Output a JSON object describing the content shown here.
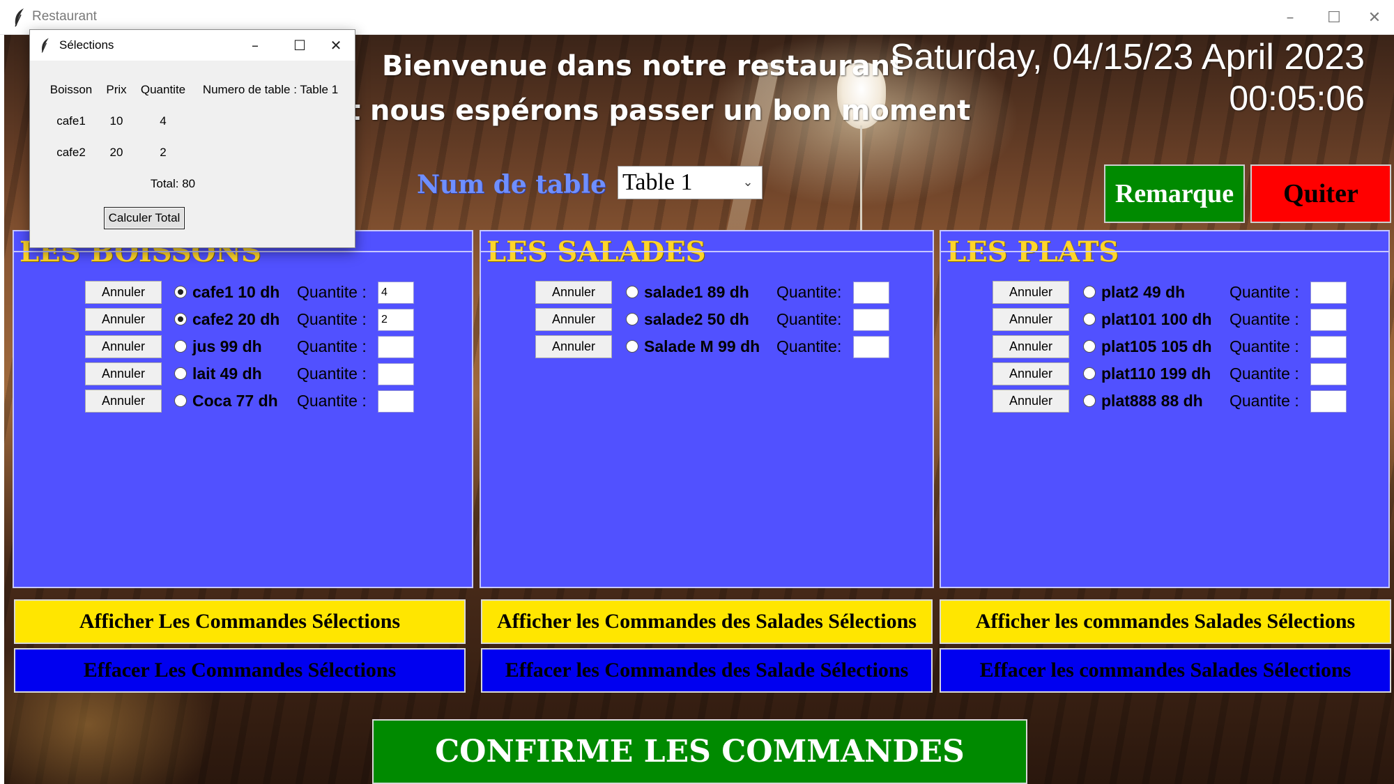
{
  "window": {
    "title": "Restaurant"
  },
  "header": {
    "welcome_line1": "Bienvenue dans notre restaurant",
    "welcome_line2": "t nous espérons passer un bon moment",
    "date": "Saturday, 04/15/23 April 2023",
    "time": "00:05:06"
  },
  "table_select": {
    "label": "Num de table",
    "value": "Table 1"
  },
  "buttons": {
    "remarque": "Remarque",
    "quiter": "Quiter",
    "confirm": "CONFIRME LES COMMANDES"
  },
  "colors": {
    "panel": "#5151ff",
    "title_yellow": "#ffd52a",
    "remarque_bg": "#008a00",
    "quiter_bg": "#ff0000",
    "show_btn": "#ffe600",
    "clear_btn": "#0000f0"
  },
  "boissons": {
    "title": "LES BOISSONS",
    "items": [
      {
        "cancel": "Annuler",
        "label": "cafe1 10 dh",
        "qty_label": "Quantite :",
        "qty": "4",
        "selected": true
      },
      {
        "cancel": "Annuler",
        "label": "cafe2 20 dh",
        "qty_label": "Quantite :",
        "qty": "2",
        "selected": true
      },
      {
        "cancel": "Annuler",
        "label": "jus 99 dh",
        "qty_label": "Quantite :",
        "qty": "",
        "selected": false
      },
      {
        "cancel": "Annuler",
        "label": "lait 49 dh",
        "qty_label": "Quantite :",
        "qty": "",
        "selected": false
      },
      {
        "cancel": "Annuler",
        "label": "Coca 77 dh",
        "qty_label": "Quantite :",
        "qty": "",
        "selected": false
      }
    ],
    "show_button": "Afficher  Les Commandes Sélections",
    "clear_button": "Effacer Les Commandes Sélections"
  },
  "salades": {
    "title": "LES SALADES",
    "items": [
      {
        "cancel": "Annuler",
        "label": "salade1 89 dh",
        "qty_label": "Quantite:",
        "qty": "",
        "selected": false
      },
      {
        "cancel": "Annuler",
        "label": "salade2 50 dh",
        "qty_label": "Quantite:",
        "qty": "",
        "selected": false
      },
      {
        "cancel": "Annuler",
        "label": "Salade M 99 dh",
        "qty_label": "Quantite:",
        "qty": "",
        "selected": false
      }
    ],
    "show_button": "Afficher les Commandes des Salades Sélections",
    "clear_button": "Effacer les Commandes des Salade Sélections"
  },
  "plats": {
    "title": "LES PLATS",
    "items": [
      {
        "cancel": "Annuler",
        "label": "plat2 49 dh",
        "qty_label": "Quantite :",
        "qty": "",
        "selected": false
      },
      {
        "cancel": "Annuler",
        "label": "plat101 100 dh",
        "qty_label": "Quantite :",
        "qty": "",
        "selected": false
      },
      {
        "cancel": "Annuler",
        "label": "plat105 105 dh",
        "qty_label": "Quantite :",
        "qty": "",
        "selected": false
      },
      {
        "cancel": "Annuler",
        "label": "plat110 199 dh",
        "qty_label": "Quantite :",
        "qty": "",
        "selected": false
      },
      {
        "cancel": "Annuler",
        "label": "plat888 88 dh",
        "qty_label": "Quantite :",
        "qty": "",
        "selected": false
      }
    ],
    "show_button": "Afficher les commandes Salades Sélections",
    "clear_button": "Effacer les commandes Salades Sélections"
  },
  "popup": {
    "title": "Sélections",
    "headers": [
      "Boisson",
      "Prix",
      "Quantite",
      "Numero de table : Table 1"
    ],
    "rows": [
      {
        "name": "cafe1",
        "price": "10",
        "qty": "4"
      },
      {
        "name": "cafe2",
        "price": "20",
        "qty": "2"
      }
    ],
    "total": "Total: 80",
    "button": "Calculer Total"
  }
}
